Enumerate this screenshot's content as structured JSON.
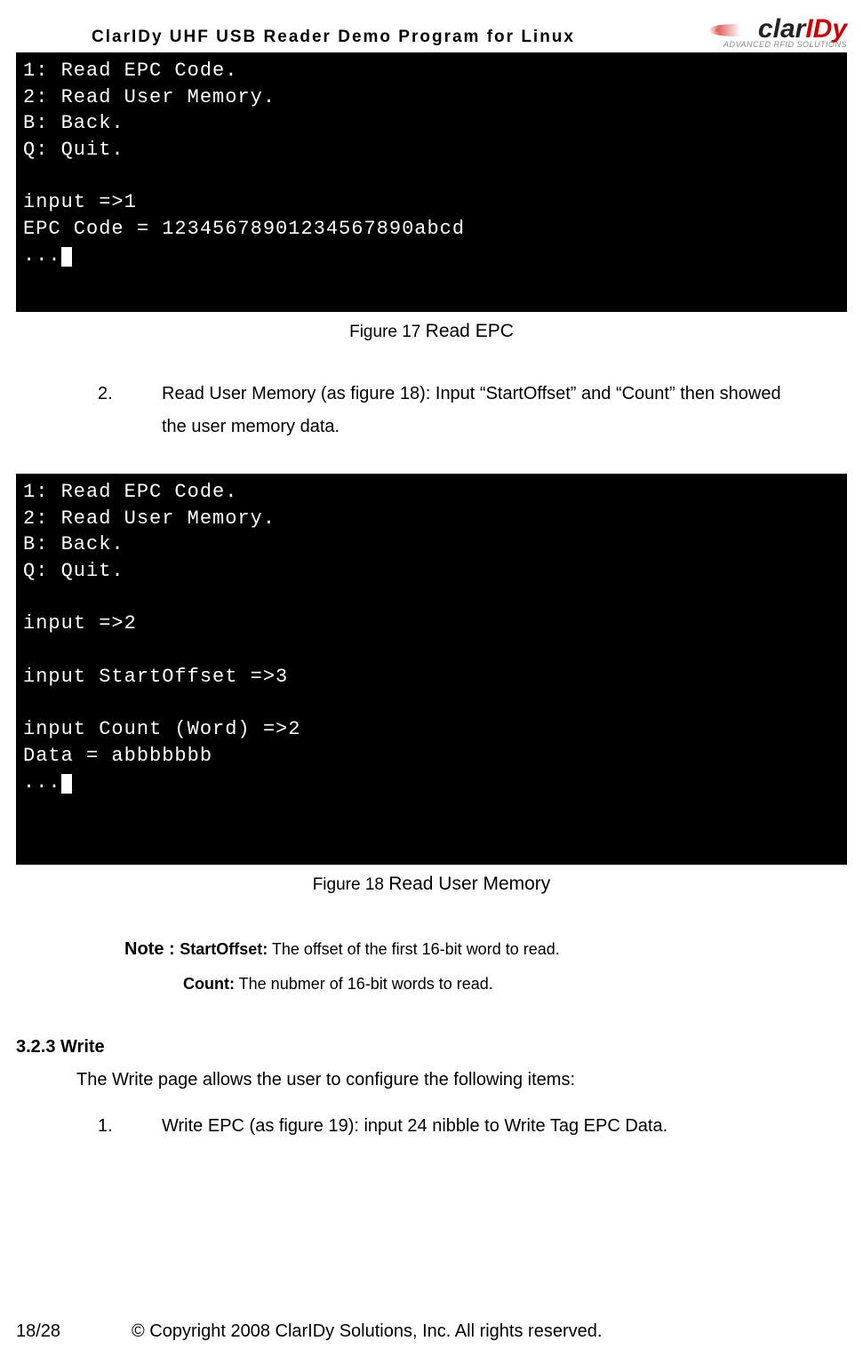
{
  "header": {
    "doc_title": "ClarIDy  UHF  USB  Reader  Demo  Program  for  Linux",
    "logo_main_prefix": "clar",
    "logo_main_suffix": "IDy",
    "logo_tagline": "ADVANCED RFID SOLUTIONS"
  },
  "terminal1": {
    "line1": "1: Read EPC Code.",
    "line2": "2: Read User Memory.",
    "line3": "B: Back.",
    "line4": "Q: Quit.",
    "line5": "",
    "line6": "input =>1",
    "line7": "EPC Code = 12345678901234567890abcd",
    "line8_prefix": "..."
  },
  "fig17_label": "Figure 17 ",
  "fig17_title": "Read EPC",
  "para2_num": "2.",
  "para2_text": "Read User Memory (as figure 18): Input “StartOffset” and “Count” then showed the user memory data.",
  "terminal2": {
    "line1": "1: Read EPC Code.",
    "line2": "2: Read User Memory.",
    "line3": "B: Back.",
    "line4": "Q: Quit.",
    "line5": "",
    "line6": "input =>2",
    "line7": "",
    "line8": "input StartOffset =>3",
    "line9": "",
    "line10": "input Count (Word) =>2",
    "line11": "Data = abbbbbbb",
    "line12_prefix": "..."
  },
  "fig18_label": "Figure 18 ",
  "fig18_title": "Read User Memory",
  "note": {
    "label": "Note : ",
    "startoffset_key": "StartOffset:",
    "startoffset_desc": " The offset of the first 16-bit word to read.",
    "count_key": "Count:",
    "count_desc": " The nubmer of 16-bit words to read."
  },
  "section": {
    "heading": "3.2.3 Write",
    "intro": "The Write page allows the user to configure the following items:",
    "item1_num": "1.",
    "item1_text": "Write EPC (as figure 19): input 24 nibble to Write Tag EPC Data."
  },
  "footer": {
    "page": "18/28",
    "copyright": "© Copyright 2008 ClarIDy Solutions, Inc. All rights reserved."
  }
}
